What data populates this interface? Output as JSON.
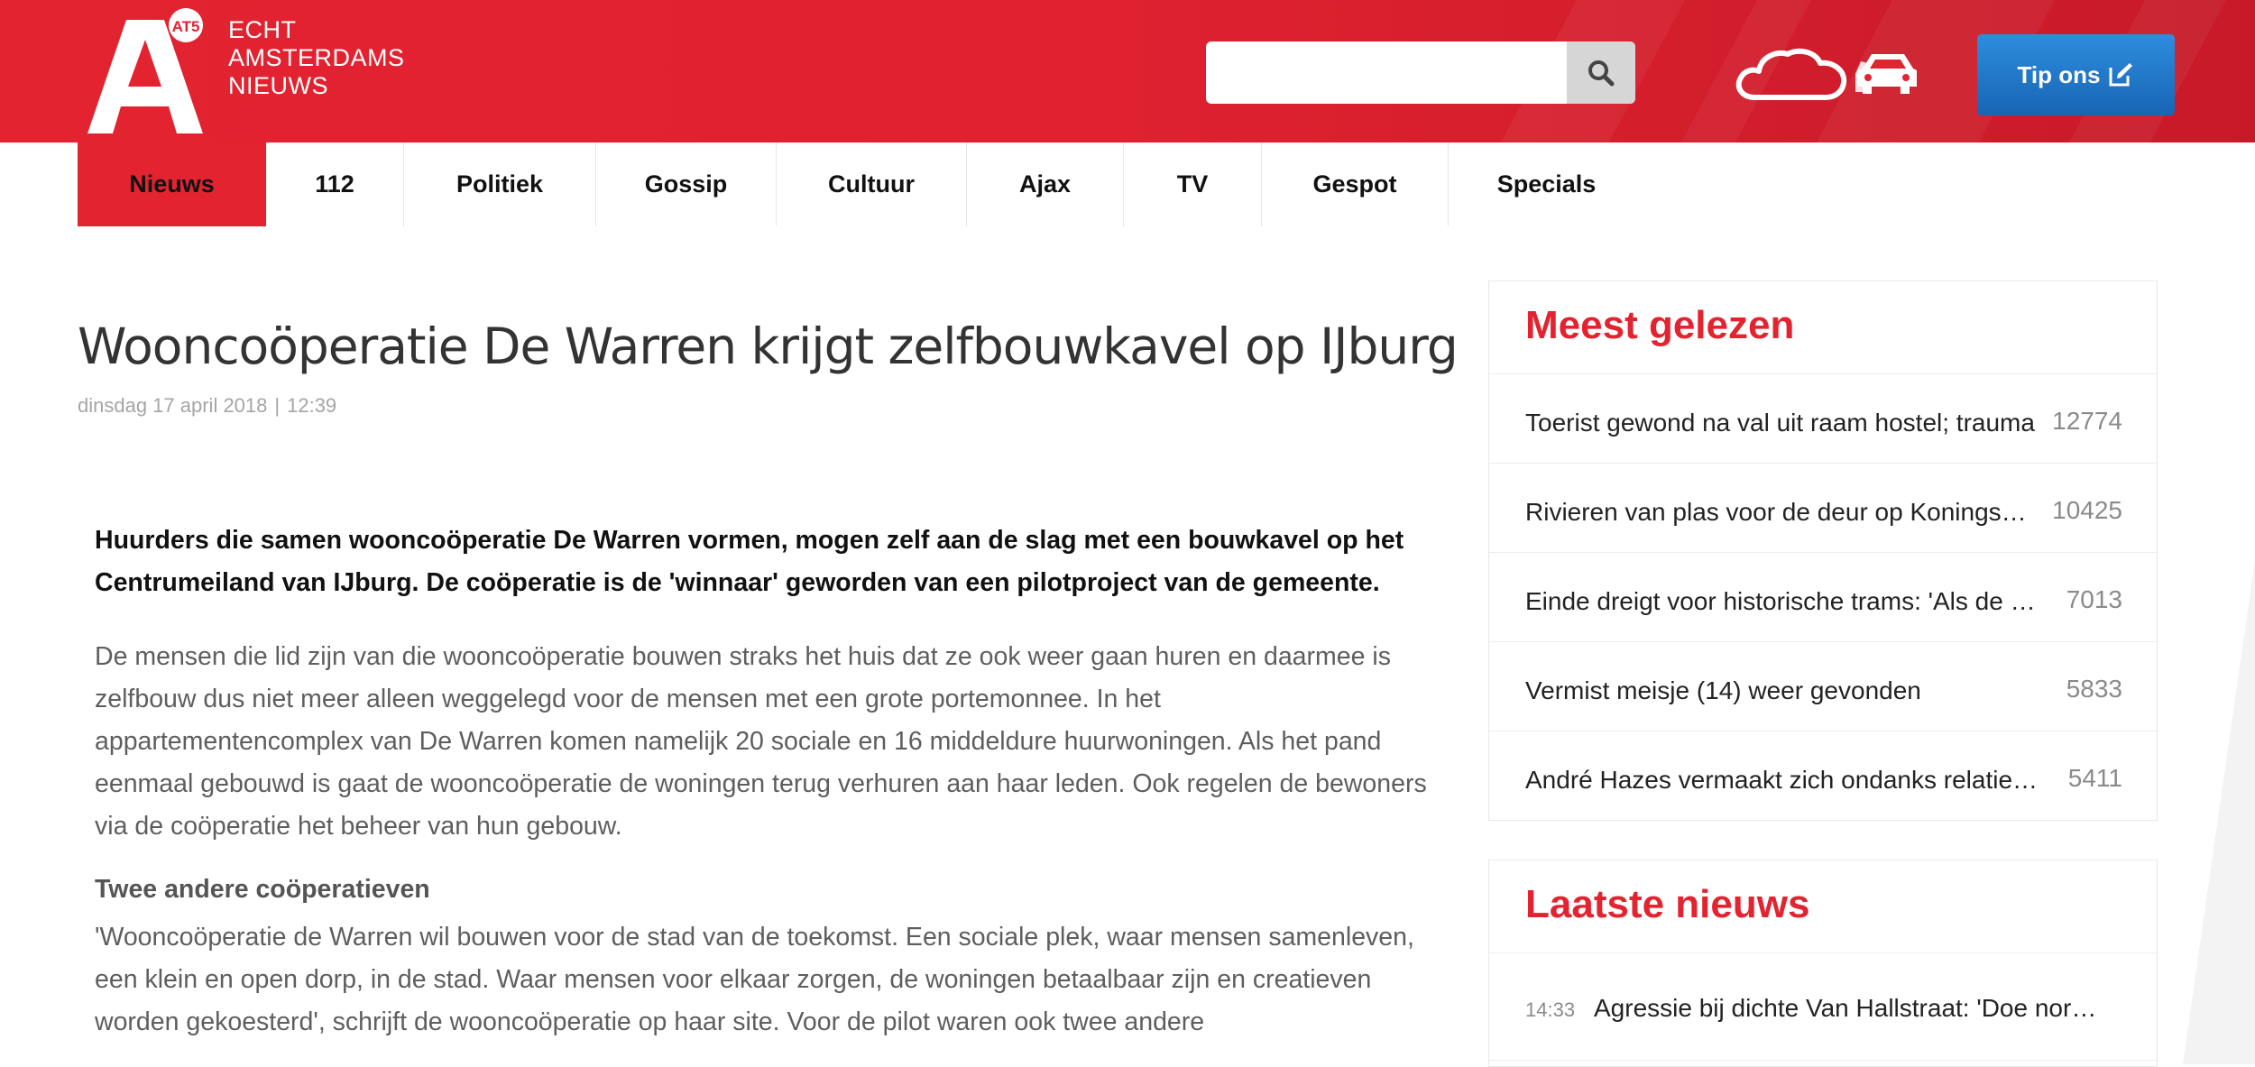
{
  "header": {
    "logo_badge": "AT5",
    "logo_lines": [
      "ECHT",
      "AMSTERDAMS",
      "NIEUWS"
    ],
    "search": {
      "placeholder": "",
      "value": ""
    },
    "icons": [
      "search-icon",
      "cloud-icon",
      "car-icon",
      "edit-icon"
    ],
    "tip_label": "Tip ons"
  },
  "nav": {
    "items": [
      "Nieuws",
      "112",
      "Politiek",
      "Gossip",
      "Cultuur",
      "Ajax",
      "TV",
      "Gespot",
      "Specials"
    ],
    "active": "Nieuws"
  },
  "article": {
    "title": "Wooncoöperatie De Warren krijgt zelfbouwkavel op IJburg",
    "date": "dinsdag 17 april 2018",
    "separator": "|",
    "time": "12:39",
    "lead": "Huurders die samen wooncoöperatie De Warren vormen, mogen zelf aan de slag met een bouwkavel op het Centrumeiland van IJburg. De coöperatie is de 'winnaar' geworden van een pilotproject van de gemeente.",
    "paragraph1": "De mensen die lid zijn van die wooncoöperatie bouwen straks het huis dat ze ook weer gaan huren en daarmee is zelfbouw dus niet meer alleen weggelegd voor de mensen met een grote portemonnee. In het appartementencomplex van De Warren komen namelijk 20 sociale en 16 middeldure huurwoningen. Als het pand eenmaal gebouwd is gaat de wooncoöperatie de woningen terug verhuren aan haar leden. Ook regelen de bewoners via de coöperatie het beheer van hun gebouw.",
    "subheading": "Twee andere coöperatieven",
    "paragraph2": "'Wooncoöperatie de Warren wil bouwen voor de stad van de toekomst. Een sociale plek, waar mensen samenleven, een klein en open dorp, in de stad. Waar mensen voor elkaar zorgen, de woningen betaalbaar zijn en creatieven worden gekoesterd', schrijft de wooncoöperatie op haar site. Voor de pilot waren ook twee andere"
  },
  "sidebar": {
    "most_read": {
      "title": "Meest gelezen",
      "items": [
        {
          "title": "Toerist gewond na val uit raam hostel; trauma",
          "count": "12774"
        },
        {
          "title": "Rivieren van plas voor de deur op Koningsdag",
          "count": "10425"
        },
        {
          "title": "Einde dreigt voor historische trams: 'Als de gemeente",
          "count": "7013"
        },
        {
          "title": "Vermist meisje (14) weer gevonden",
          "count": "5833"
        },
        {
          "title": "André Hazes vermaakt zich ondanks relatiebreuk",
          "count": "5411"
        }
      ]
    },
    "latest": {
      "title": "Laatste nieuws",
      "items": [
        {
          "time": "14:33",
          "title": "Agressie bij dichte Van Hallstraat: 'Doe normaal'"
        }
      ]
    }
  },
  "colors": {
    "brand_red": "#e32330",
    "tip_blue": "#1f73c6"
  }
}
